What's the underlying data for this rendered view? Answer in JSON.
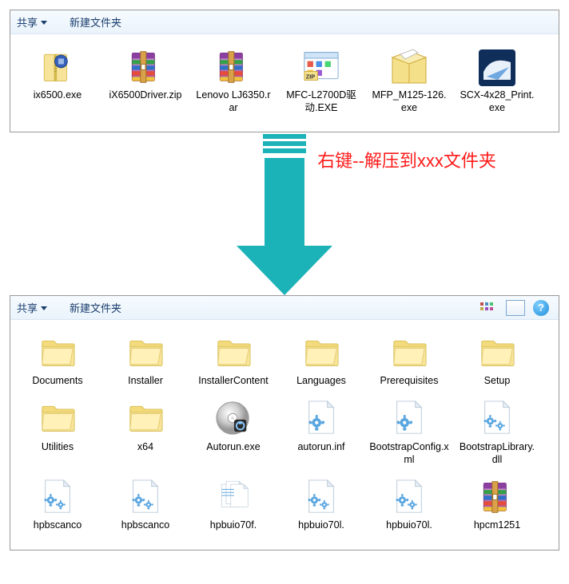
{
  "annotation": "右键--解压到xxx文件夹",
  "toolbar": {
    "share": "共享",
    "newFolder": "新建文件夹",
    "help": "?"
  },
  "panel1": {
    "files": [
      {
        "name": "ix6500.exe",
        "icon": "zip-yellow"
      },
      {
        "name": "iX6500Driver.zip",
        "icon": "rar"
      },
      {
        "name": "Lenovo LJ6350.rar",
        "icon": "rar"
      },
      {
        "name": "MFC-L2700D驱动.EXE",
        "icon": "window-exe"
      },
      {
        "name": "MFP_M125-126.exe",
        "icon": "box-exe"
      },
      {
        "name": "SCX-4x28_Print.exe",
        "icon": "blue-exe"
      }
    ]
  },
  "panel2": {
    "files": [
      {
        "name": "Documents",
        "icon": "folder"
      },
      {
        "name": "Installer",
        "icon": "folder"
      },
      {
        "name": "InstallerContent",
        "icon": "folder"
      },
      {
        "name": "Languages",
        "icon": "folder"
      },
      {
        "name": "Prerequisites",
        "icon": "folder"
      },
      {
        "name": "Setup",
        "icon": "folder"
      },
      {
        "name": "Utilities",
        "icon": "folder"
      },
      {
        "name": "x64",
        "icon": "folder"
      },
      {
        "name": "Autorun.exe",
        "icon": "disc"
      },
      {
        "name": "autorun.inf",
        "icon": "inf"
      },
      {
        "name": "BootstrapConfig.xml",
        "icon": "xml"
      },
      {
        "name": "BootstrapLibrary.dll",
        "icon": "dll"
      },
      {
        "name": "hpbscanco",
        "icon": "dll"
      },
      {
        "name": "hpbscanco",
        "icon": "dll"
      },
      {
        "name": "hpbuio70f.",
        "icon": "multi"
      },
      {
        "name": "hpbuio70l.",
        "icon": "dll"
      },
      {
        "name": "hpbuio70l.",
        "icon": "dll"
      },
      {
        "name": "hpcm1251",
        "icon": "rar"
      }
    ]
  }
}
